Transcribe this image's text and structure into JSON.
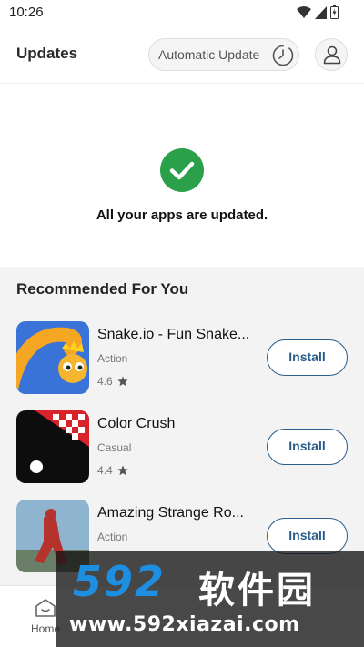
{
  "status_bar": {
    "time": "10:26"
  },
  "header": {
    "title": "Updates",
    "auto_update_label": "Automatic Update"
  },
  "status_message": "All your apps are updated.",
  "recommended": {
    "title": "Recommended For You",
    "apps": [
      {
        "name": "Snake.io - Fun Snake...",
        "category": "Action",
        "rating": "4.6",
        "install_label": "Install"
      },
      {
        "name": "Color Crush",
        "category": "Casual",
        "rating": "4.4",
        "install_label": "Install"
      },
      {
        "name": "Amazing Strange Ro...",
        "category": "Action",
        "rating": "",
        "install_label": "Install"
      }
    ]
  },
  "bottom_nav": {
    "home_label": "Home"
  },
  "watermark": {
    "numbers": "592",
    "name": "软件园",
    "url": "www.592xiazai.com"
  },
  "colors": {
    "accent": "#2a5d8a",
    "success": "#2aa04a",
    "watermark_blue": "#1e8ee0"
  }
}
